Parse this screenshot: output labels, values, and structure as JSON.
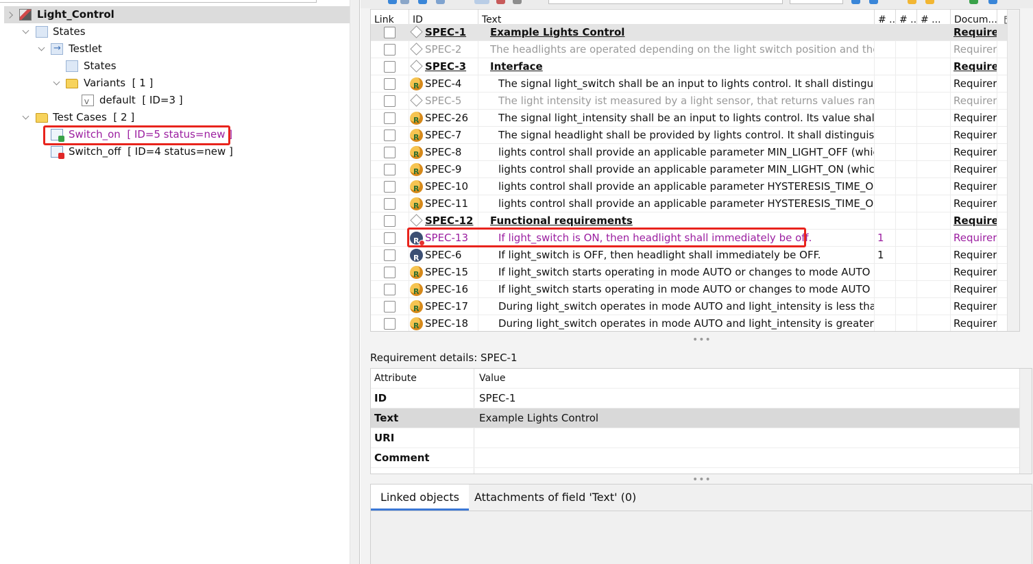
{
  "tree": {
    "root": "Light_Control",
    "states_folder": "States",
    "testlet": "Testlet",
    "testlet_states": "States",
    "variants": "Variants",
    "variants_count": "[ 1 ]",
    "variant_default": "default",
    "variant_default_info": "[ ID=3 ]",
    "test_cases": "Test Cases",
    "test_cases_count": "[ 2 ]",
    "tc_on": "Switch_on",
    "tc_on_info": "[ ID=5 status=new ]",
    "tc_off": "Switch_off",
    "tc_off_info": "[ ID=4 status=new ]"
  },
  "requirements": {
    "headers": {
      "link": "Link",
      "id": "ID",
      "text": "Text",
      "n1": "# ...",
      "n2": "# ...",
      "n3": "# ...",
      "doc": "Docum...",
      "settings_icon": "table-settings-icon"
    },
    "rows": [
      {
        "id": "SPEC-1",
        "text": "Example Lights Control",
        "n1": "",
        "doc": "Requirer",
        "kind": "heading"
      },
      {
        "id": "SPEC-2",
        "text": "The headlights are operated depending on the light switch position and the l",
        "n1": "",
        "doc": "Requirer",
        "kind": "grey"
      },
      {
        "id": "SPEC-3",
        "text": "Interface",
        "n1": "",
        "doc": "Requirer",
        "kind": "heading"
      },
      {
        "id": "SPEC-4",
        "text": "The signal light_switch shall be an input to lights control. It shall distinguish",
        "n1": "",
        "doc": "Requirer",
        "kind": "req"
      },
      {
        "id": "SPEC-5",
        "text": "The light intensity ist measured by a light sensor, that returns values ranging",
        "n1": "",
        "doc": "Requirer",
        "kind": "grey"
      },
      {
        "id": "SPEC-26",
        "text": "The signal light_intensity shall be an input to lights control. Its value shall rar",
        "n1": "",
        "doc": "Requirer",
        "kind": "req"
      },
      {
        "id": "SPEC-7",
        "text": "The signal headlight shall be provided by lights control. It shall distinguish t",
        "n1": "",
        "doc": "Requirer",
        "kind": "req"
      },
      {
        "id": "SPEC-8",
        "text": "lights control shall provide an applicable parameter MIN_LIGHT_OFF (which",
        "n1": "",
        "doc": "Requirer",
        "kind": "req"
      },
      {
        "id": "SPEC-9",
        "text": "lights control shall provide an applicable parameter MIN_LIGHT_ON (which",
        "n1": "",
        "doc": "Requirer",
        "kind": "req"
      },
      {
        "id": "SPEC-10",
        "text": "lights control shall provide an applicable parameter HYSTERESIS_TIME_ON,",
        "n1": "",
        "doc": "Requirer",
        "kind": "req"
      },
      {
        "id": "SPEC-11",
        "text": "lights control shall provide an applicable parameter HYSTERESIS_TIME_OFF,",
        "n1": "",
        "doc": "Requirer",
        "kind": "req"
      },
      {
        "id": "SPEC-12",
        "text": "Functional requirements",
        "n1": "",
        "doc": "Requirer",
        "kind": "heading"
      },
      {
        "id": "SPEC-13",
        "text": "If light_switch is ON, then headlight shall immediately be off.",
        "n1": "1",
        "doc": "Requirer",
        "kind": "highlight"
      },
      {
        "id": "SPEC-6",
        "text": "If light_switch is OFF, then headlight shall immediately be OFF.",
        "n1": "1",
        "doc": "Requirer",
        "kind": "dark"
      },
      {
        "id": "SPEC-15",
        "text": "If light_switch starts operating in mode AUTO or changes to mode AUTO du",
        "n1": "",
        "doc": "Requirer",
        "kind": "req"
      },
      {
        "id": "SPEC-16",
        "text": "If light_switch starts operating in mode AUTO or changes to mode AUTO du",
        "n1": "",
        "doc": "Requirer",
        "kind": "req"
      },
      {
        "id": "SPEC-17",
        "text": "During light_switch operates in mode AUTO and light_intensity is less than I",
        "n1": "",
        "doc": "Requirer",
        "kind": "req"
      },
      {
        "id": "SPEC-18",
        "text": "During light_switch operates in mode AUTO and light_intensity is greater th",
        "n1": "",
        "doc": "Requirer",
        "kind": "req"
      }
    ]
  },
  "details": {
    "title": "Requirement details: SPEC-1",
    "header_attribute": "Attribute",
    "header_value": "Value",
    "rows": [
      {
        "key": "ID",
        "value": "SPEC-1"
      },
      {
        "key": "Text",
        "value": "Example Lights Control"
      },
      {
        "key": "URI",
        "value": ""
      },
      {
        "key": "Comment",
        "value": ""
      }
    ]
  },
  "tabs": {
    "linked": "Linked objects",
    "attachments": "Attachments of field 'Text' (0)"
  },
  "sash_glyph": "•••",
  "colors": {
    "highlight_purple": "#9b1ea0",
    "annotation_red": "#e8231c",
    "selected_row": "#d9d9d9",
    "tab_accent": "#3a77d6"
  }
}
